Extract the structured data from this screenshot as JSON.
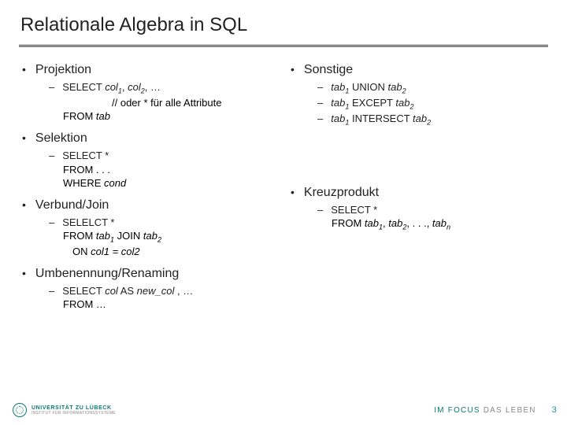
{
  "title": "Relationale Algebra in SQL",
  "left": {
    "projektion": {
      "heading": "Projektion",
      "l1a": "SELECT ",
      "l1b": "col",
      "l1c": ", ",
      "l1d": "col",
      "l1e": ", …",
      "l2": "// oder * für alle Attribute",
      "l3a": "FROM ",
      "l3b": "tab"
    },
    "selektion": {
      "heading": "Selektion",
      "l1": "SELECT *",
      "l2": "FROM . . .",
      "l3a": "WHERE ",
      "l3b": "cond"
    },
    "verbund": {
      "heading": "Verbund/Join",
      "l1": "SELELCT *",
      "l2a": "FROM ",
      "l2b": "tab",
      "l2c": " JOIN ",
      "l2d": "tab",
      "l3a": "ON ",
      "l3b": "col1 = col2"
    },
    "umbenennung": {
      "heading": "Umbenennung/Renaming",
      "l1a": "SELECT ",
      "l1b": "col",
      "l1c": " AS ",
      "l1d": "new_col",
      "l1e": " , …",
      "l2": "FROM …"
    }
  },
  "right": {
    "sonstige": {
      "heading": "Sonstige",
      "r1a": "tab",
      "r1b": " UNION ",
      "r1c": "tab",
      "r2a": "tab",
      "r2b": " EXCEPT ",
      "r2c": "tab",
      "r3a": "tab",
      "r3b": " INTERSECT ",
      "r3c": "tab"
    },
    "kreuz": {
      "heading": "Kreuzprodukt",
      "l1": "SELECT *",
      "l2a": "FROM ",
      "l2b": "tab",
      "l2c": ", ",
      "l2d": "tab",
      "l2e": ", . . ., ",
      "l2f": "tab"
    }
  },
  "footer": {
    "uni_top": "UNIVERSITÄT ZU LÜBECK",
    "uni_bot": "INSTITUT FÜR INFORMATIONSSYSTEME",
    "motto_a": "IM FOCUS",
    "motto_b": " DAS LEBEN",
    "page": "3"
  }
}
